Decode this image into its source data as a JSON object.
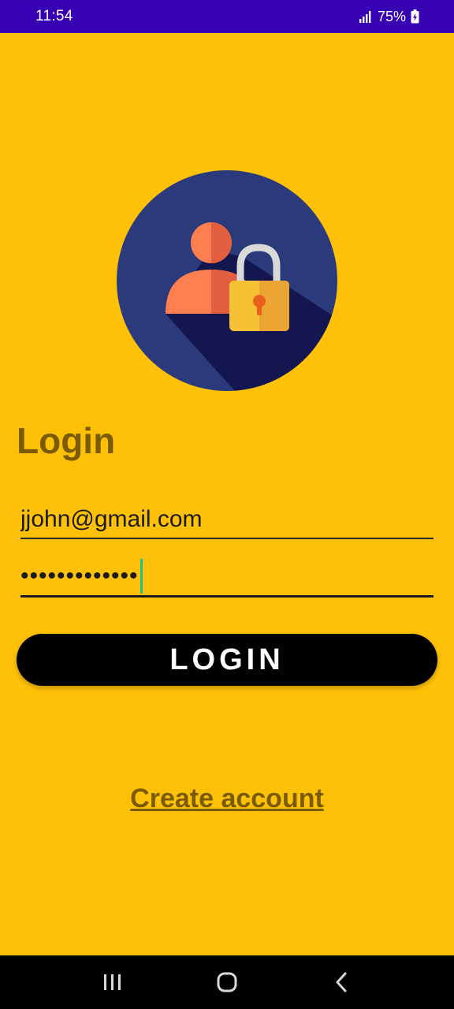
{
  "status_bar": {
    "time": "11:54",
    "battery": "75%"
  },
  "page": {
    "title": "Login"
  },
  "form": {
    "email_value": "jjohn@gmail.com",
    "password_masked": "•••••••••••••"
  },
  "actions": {
    "login_label": "LOGIN",
    "create_account_label": "Create account"
  },
  "colors": {
    "background": "#FFC107",
    "status_bar": "#3700B3",
    "accent_text": "#7A5B00",
    "button": "#000000"
  },
  "icons": {
    "logo": "user-lock-icon",
    "nav_recent": "recent-apps-icon",
    "nav_home": "home-icon",
    "nav_back": "back-icon"
  }
}
